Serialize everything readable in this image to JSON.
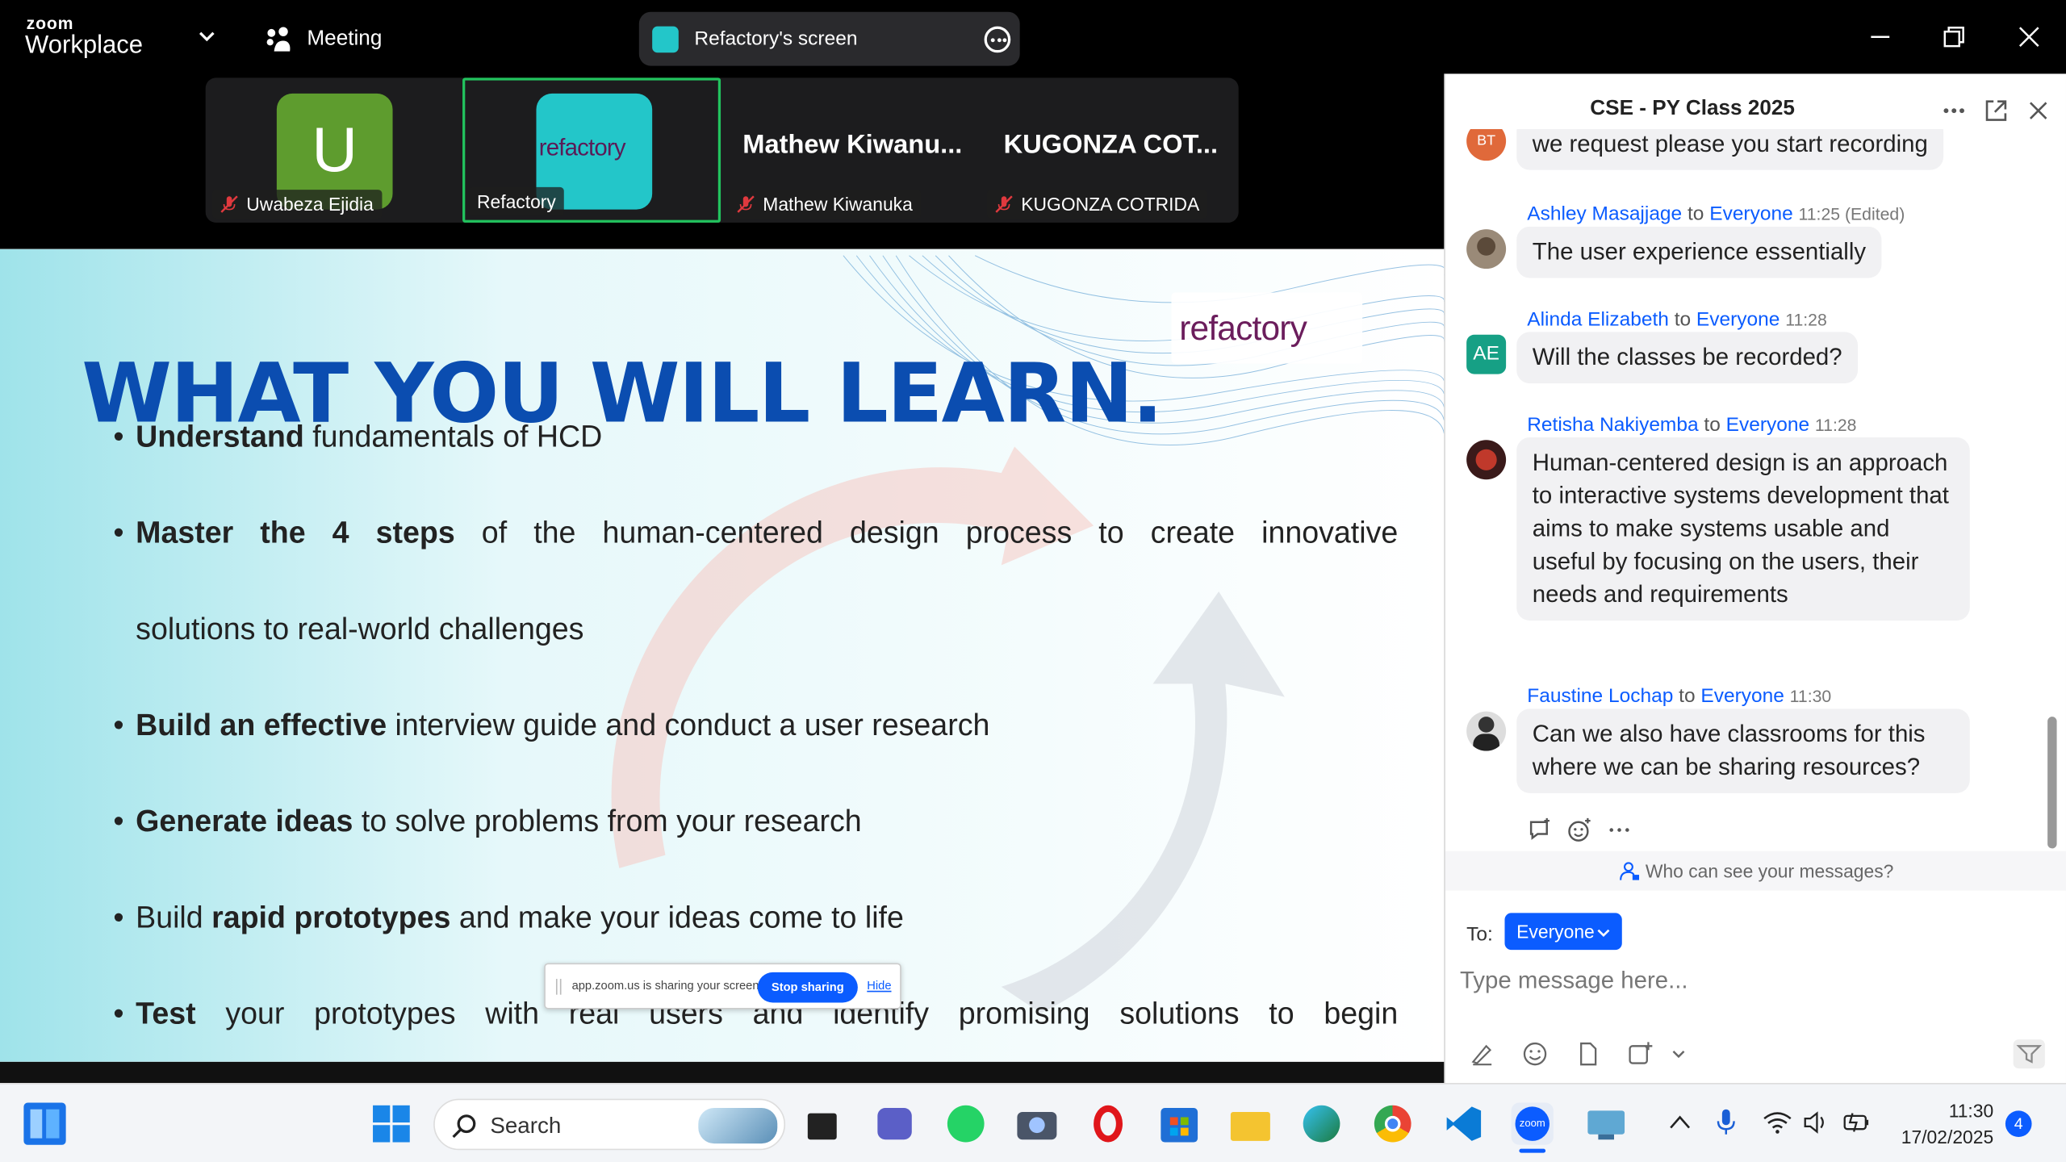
{
  "titlebar": {
    "logo_small": "zoom",
    "logo_big": "Workplace",
    "meeting_label": "Meeting",
    "share_label": "Refactory's screen"
  },
  "participants": [
    {
      "initial": "U",
      "name": "Uwabeza Ejidia",
      "muted": true,
      "avatar_color": "#5e9c2e"
    },
    {
      "logo": "refactory",
      "name": "Refactory",
      "muted": false,
      "active_speaker": true
    },
    {
      "display": "Mathew Kiwanu...",
      "name": "Mathew Kiwanuka",
      "muted": true
    },
    {
      "display": "KUGONZA COT...",
      "name": "KUGONZA COTRIDA",
      "muted": true
    }
  ],
  "slide": {
    "title": "WHAT YOU WILL LEARN.",
    "logo": "refactory",
    "bullets": [
      {
        "bold": "Understand",
        "text": " fundamentals of HCD"
      },
      {
        "bold": "Master the 4 steps",
        "text": " of the human-centered design process to create innovative"
      },
      {
        "bold": "",
        "text": "solutions to real-world challenges"
      },
      {
        "bold": "Build an effective",
        "text": " interview guide and conduct a user research"
      },
      {
        "bold": "Generate ideas",
        "text": " to solve problems from your research"
      },
      {
        "pre": "Build ",
        "bold": "rapid prototypes",
        "text": " and make your ideas come to life"
      },
      {
        "bold": "Test",
        "text": " your prototypes with real users and identify promising solutions to begin"
      }
    ]
  },
  "sharebar": {
    "message": "app.zoom.us is sharing your screen.",
    "stop": "Stop sharing",
    "hide": "Hide"
  },
  "chat": {
    "title": "CSE - PY Class 2025",
    "partial_message": "we request please you start recording",
    "partial_avatar": "BT",
    "messages": [
      {
        "sender": "Ashley Masajjage",
        "to": "to",
        "recipient": "Everyone",
        "time": "11:25 (Edited)",
        "text": "The user experience essentially"
      },
      {
        "sender": "Alinda Elizabeth",
        "to": "to",
        "recipient": "Everyone",
        "time": "11:28",
        "text": "Will the classes be recorded?",
        "initials": "AE"
      },
      {
        "sender": "Retisha Nakiyemba",
        "to": "to",
        "recipient": "Everyone",
        "time": "11:28",
        "text": "Human-centered design is an approach to interactive systems development that aims to make systems usable and useful by focusing on the users, their needs and requirements"
      },
      {
        "sender": "Faustine Lochap",
        "to": "to",
        "recipient": "Everyone",
        "time": "11:30",
        "text": "Can we also have classrooms for this where we can be sharing resources?"
      }
    ],
    "who_can_see": "Who can see your messages?",
    "to_label": "To:",
    "to_value": "Everyone",
    "input_placeholder": "Type message here..."
  },
  "taskbar": {
    "search_label": "Search",
    "time": "11:30",
    "date": "17/02/2025",
    "notifications": "4"
  },
  "colors": {
    "accent": "#0b5cff",
    "slide_title": "#0b4db0",
    "active_tile_border": "#22c35e"
  }
}
